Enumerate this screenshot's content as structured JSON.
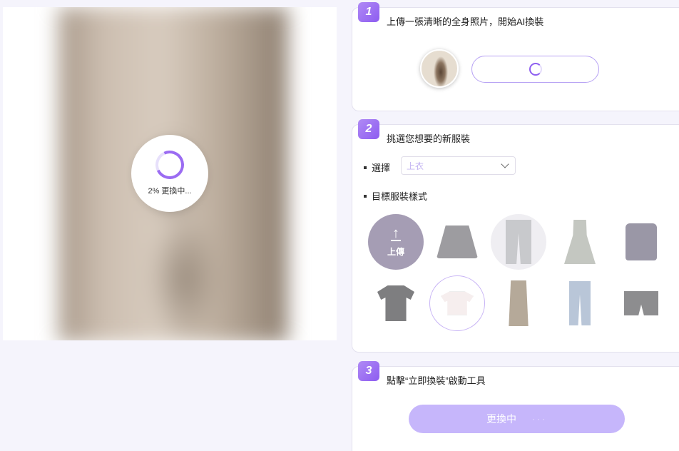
{
  "preview": {
    "progress_text": "2% 更換中...",
    "progress_value": 2
  },
  "step1": {
    "number": "1",
    "title": "上傳一張清晰的全身照片，開始AI換裝"
  },
  "step2": {
    "number": "2",
    "title": "挑選您想要的新服裝",
    "select_label": "選擇",
    "select_value": "上衣",
    "styles_label": "目標服裝樣式",
    "upload_label": "上傳",
    "items": [
      {
        "name": "skirt",
        "selected": false
      },
      {
        "name": "jeans",
        "selected": false
      },
      {
        "name": "dress",
        "selected": false
      },
      {
        "name": "cami-top",
        "selected": false
      },
      {
        "name": "t-shirt",
        "selected": false
      },
      {
        "name": "crop-top",
        "selected": true
      },
      {
        "name": "bodycon-dress",
        "selected": false
      },
      {
        "name": "light-jeans",
        "selected": false
      },
      {
        "name": "shorts",
        "selected": false
      }
    ]
  },
  "step3": {
    "number": "3",
    "title": "點擊“立即換裝”啟動工具",
    "button_label": "更換中",
    "button_dots": "···"
  },
  "colors": {
    "accent": "#9b6cf2",
    "button": "#c6b6fb",
    "background": "#f5f4fc"
  }
}
